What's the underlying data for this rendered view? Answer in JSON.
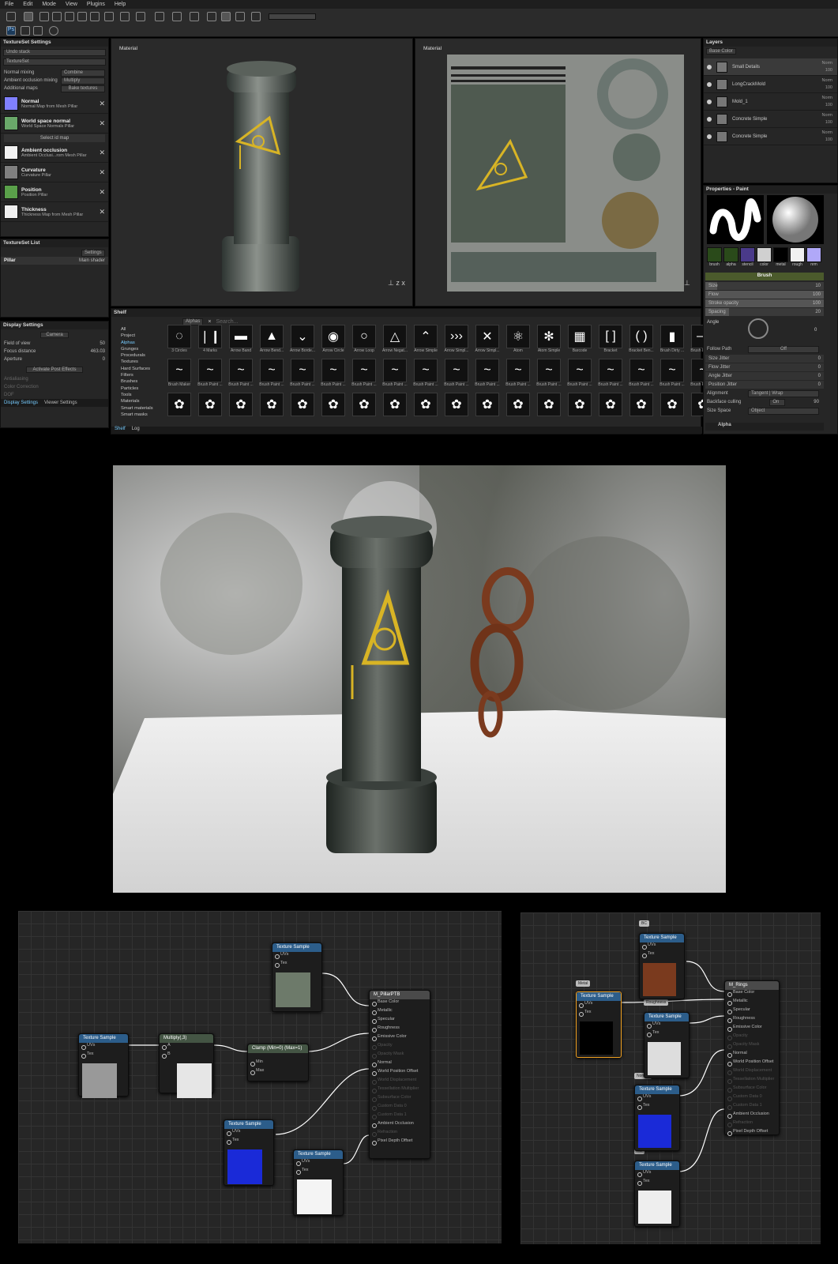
{
  "menu": [
    "File",
    "Edit",
    "Mode",
    "View",
    "Plugins",
    "Help"
  ],
  "textureset_settings": {
    "title": "TextureSet Settings",
    "undo_stack": "Undo stack",
    "textureset": "TextureSet",
    "normal_mixing_label": "Normal mixing",
    "normal_mixing_value": "Combine",
    "ao_mixing_label": "Ambient occlusion mixing",
    "ao_mixing_value": "Multiply",
    "additional_maps_label": "Additional maps",
    "bake_button": "Bake textures",
    "maps": [
      {
        "name": "Normal",
        "sub": "Normal Map from Mesh Pillar",
        "color": "#8080ff"
      },
      {
        "name": "World space normal",
        "sub": "World Space Normals Pillar",
        "color": "#6aa86a"
      },
      {
        "name": "",
        "sub": "Select id map",
        "color": ""
      },
      {
        "name": "Ambient occlusion",
        "sub": "Ambient Occlusi...rom Mesh Pillar",
        "color": "#f2f2f2"
      },
      {
        "name": "Curvature",
        "sub": "Curvature Pillar",
        "color": "#808080"
      },
      {
        "name": "Position",
        "sub": "Position Pillar",
        "color": "#5aa04a"
      },
      {
        "name": "Thickness",
        "sub": "Thickness Map from Mesh Pillar",
        "color": "#f0f0f0"
      }
    ]
  },
  "textureset_list": {
    "title": "TextureSet List",
    "settings_button": "Settings",
    "item": "Pillar",
    "shader": "Main shader"
  },
  "display_settings": {
    "title": "Display Settings",
    "camera_button": "Camera",
    "fov_label": "Field of view",
    "fov_value": "50",
    "focus_label": "Focus distance",
    "focus_value": "463.03",
    "aperture_label": "Aperture",
    "aperture_value": "0",
    "post_effects": "Activate Post Effects",
    "antialiasing": "Antialiasing",
    "color_correction": "Color Correction",
    "dof": "DOF",
    "tab1": "Display Settings",
    "tab2": "Viewer Settings"
  },
  "viewport_left": {
    "label": "Material"
  },
  "viewport_right": {
    "label": "Material"
  },
  "shelf": {
    "title": "Shelf",
    "filter": "Alphas",
    "search_placeholder": "Search...",
    "categories": [
      "All",
      "Project",
      "Alphas",
      "Grunges",
      "Procedurals",
      "Textures",
      "Hard Surfaces",
      "Filters",
      "Brushes",
      "Particles",
      "Tools",
      "Materials",
      "Smart materials",
      "Smart masks"
    ],
    "row1": [
      "3 Circles",
      "4 Marks",
      "Arrow Band",
      "Arrow Bend...",
      "Arrow Borde...",
      "Arrow Circle",
      "Arrow Loop",
      "Arrow Negat...",
      "Arrow Simple",
      "Arrow Simpl...",
      "Arrow Simpl...",
      "Atom",
      "Atom Simple",
      "Barcode",
      "Bracket",
      "Bracket Ben...",
      "Brush Dirty ...",
      "Brush Long ..."
    ],
    "row2": [
      "Brush Maker",
      "Brush Paint ...",
      "Brush Paint ...",
      "Brush Paint ...",
      "Brush Paint ...",
      "Brush Paint ...",
      "Brush Paint ...",
      "Brush Paint ...",
      "Brush Paint ...",
      "Brush Paint ...",
      "Brush Paint ...",
      "Brush Paint ...",
      "Brush Paint ...",
      "Brush Paint ...",
      "Brush Paint ...",
      "Brush Paint ...",
      "Brush Paint ...",
      "Brush Paint ..."
    ],
    "tab1": "Shelf",
    "tab2": "Log"
  },
  "layers": {
    "title": "Layers",
    "channel": "Base Color",
    "items": [
      {
        "name": "Small Details",
        "blend": "Norm",
        "opacity": "100"
      },
      {
        "name": "LongCrackMold",
        "blend": "Norm",
        "opacity": "100"
      },
      {
        "name": "Mold_1",
        "blend": "Norm",
        "opacity": "100"
      },
      {
        "name": "Concrete Simple",
        "blend": "Norm",
        "opacity": "100"
      },
      {
        "name": "Concrete Simple",
        "blend": "Norm",
        "opacity": "100"
      }
    ]
  },
  "properties": {
    "title": "Properties - Paint",
    "chips": [
      "brush",
      "alpha",
      "stencil",
      "color",
      "metal",
      "rough",
      "nrm"
    ],
    "brush_header": "Brush",
    "sliders": [
      {
        "label": "Size",
        "value": "10",
        "fill": 0.1
      },
      {
        "label": "Flow",
        "value": "100",
        "fill": 1
      },
      {
        "label": "Stroke opacity",
        "value": "100",
        "fill": 1
      },
      {
        "label": "Spacing",
        "value": "20",
        "fill": 0.2
      }
    ],
    "angle_label": "Angle",
    "angle_value": "0",
    "follow_path_label": "Follow Path",
    "follow_path_value": "Off",
    "jitters": [
      {
        "label": "Size Jitter",
        "value": "0"
      },
      {
        "label": "Flow Jitter",
        "value": "0"
      },
      {
        "label": "Angle Jitter",
        "value": "0"
      },
      {
        "label": "Position Jitter",
        "value": "0"
      }
    ],
    "alignment_label": "Alignment",
    "alignment_value": "Tangent | Wrap",
    "backface_label": "Backface culling",
    "backface_toggle": "On",
    "backface_value": "90",
    "size_space_label": "Size Space",
    "size_space_value": "Object",
    "alpha_header": "Alpha"
  },
  "graph_left": {
    "material": "M_PillarPTB",
    "inputs": [
      {
        "name": "Base Color",
        "on": true
      },
      {
        "name": "Metallic",
        "on": true
      },
      {
        "name": "Specular",
        "on": true
      },
      {
        "name": "Roughness",
        "on": true
      },
      {
        "name": "Emissive Color",
        "on": true
      },
      {
        "name": "Opacity",
        "on": false
      },
      {
        "name": "Opacity Mask",
        "on": false
      },
      {
        "name": "Normal",
        "on": true
      },
      {
        "name": "World Position Offset",
        "on": true
      },
      {
        "name": "World Displacement",
        "on": false
      },
      {
        "name": "Tessellation Multiplier",
        "on": false
      },
      {
        "name": "Subsurface Color",
        "on": false
      },
      {
        "name": "Custom Data 0",
        "on": false
      },
      {
        "name": "Custom Data 1",
        "on": false
      },
      {
        "name": "Ambient Occlusion",
        "on": true
      },
      {
        "name": "Refraction",
        "on": false
      },
      {
        "name": "Pixel Depth Offset",
        "on": true
      }
    ],
    "texture_sample": "Texture Sample",
    "uvs": "UVs",
    "tex": "Tex",
    "multiply": "Multiply(,3)",
    "mul_a": "A",
    "mul_b": "B",
    "clamp": "Clamp (Min=0) (Max=1)",
    "clamp_min": "Min",
    "clamp_max": "Max"
  },
  "graph_right": {
    "material": "M_Rings",
    "inputs": [
      {
        "name": "Base Color",
        "on": true
      },
      {
        "name": "Metallic",
        "on": true
      },
      {
        "name": "Specular",
        "on": true
      },
      {
        "name": "Roughness",
        "on": true
      },
      {
        "name": "Emissive Color",
        "on": true
      },
      {
        "name": "Opacity",
        "on": false
      },
      {
        "name": "Opacity Mask",
        "on": false
      },
      {
        "name": "Normal",
        "on": true
      },
      {
        "name": "World Position Offset",
        "on": true
      },
      {
        "name": "World Displacement",
        "on": false
      },
      {
        "name": "Tessellation Multiplier",
        "on": false
      },
      {
        "name": "Subsurface Color",
        "on": false
      },
      {
        "name": "Custom Data 0",
        "on": false
      },
      {
        "name": "Custom Data 1",
        "on": false
      },
      {
        "name": "Ambient Occlusion",
        "on": true
      },
      {
        "name": "Refraction",
        "on": false
      },
      {
        "name": "Pixel Depth Offset",
        "on": true
      }
    ],
    "tags": [
      "BC",
      "Metal",
      "Roughness",
      "Normla",
      "AO"
    ],
    "texture_sample": "Texture Sample",
    "uvs": "UVs",
    "tex": "Tex"
  },
  "colors": {
    "accent": "#2c5d8a",
    "graffiti": "#d8b425",
    "rust": "#7a3a1e",
    "normal_blue": "#1a2ad8"
  }
}
